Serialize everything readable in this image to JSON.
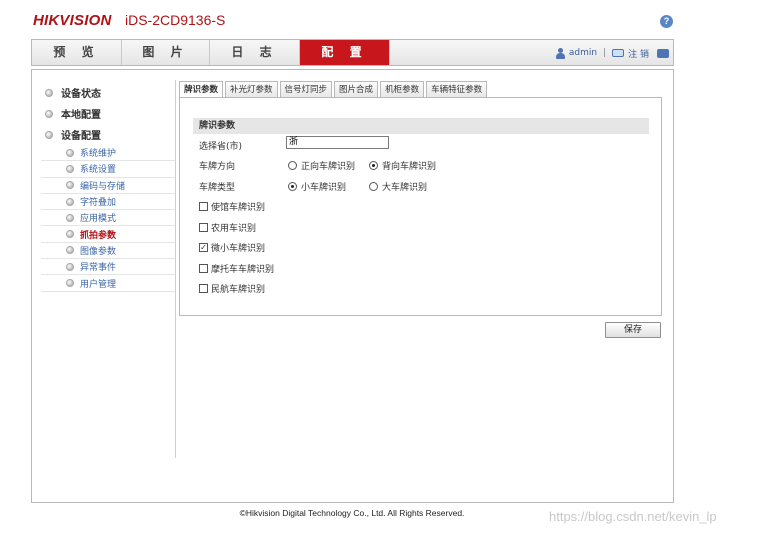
{
  "header": {
    "brand": "HIKVISION",
    "model": "iDS-2CD9136-S",
    "help_symbol": "?",
    "help_icon": "help-icon"
  },
  "nav": {
    "tabs": [
      {
        "label": "预 览"
      },
      {
        "label": "图 片"
      },
      {
        "label": "日 志"
      },
      {
        "label": "配 置"
      }
    ],
    "user": "admin",
    "separator": "|",
    "logout_label": "注 销"
  },
  "sidebar": {
    "top_items": [
      {
        "label": "设备状态"
      },
      {
        "label": "本地配置"
      },
      {
        "label": "设备配置"
      }
    ],
    "sub_items": [
      {
        "label": "系统维护"
      },
      {
        "label": "系统设置"
      },
      {
        "label": "编码与存储"
      },
      {
        "label": "字符叠加"
      },
      {
        "label": "应用模式"
      },
      {
        "label": "抓拍参数"
      },
      {
        "label": "图像参数"
      },
      {
        "label": "异常事件"
      },
      {
        "label": "用户管理"
      }
    ]
  },
  "tabs": [
    {
      "label": "牌识参数"
    },
    {
      "label": "补光灯参数"
    },
    {
      "label": "信号灯同步"
    },
    {
      "label": "图片合成"
    },
    {
      "label": "机柜参数"
    },
    {
      "label": "车辆特征参数"
    }
  ],
  "form": {
    "section_title": "牌识参数",
    "province_label": "选择省(市)",
    "province_value": "浙",
    "direction_label": "车牌方向",
    "direction_options": [
      "正向车牌识别",
      "背向车牌识别"
    ],
    "plate_type_label": "车牌类型",
    "plate_type_options": [
      "小车牌识别",
      "大车牌识别"
    ],
    "checkboxes": [
      {
        "label": "使馆车牌识别",
        "checked": false
      },
      {
        "label": "农用车识别",
        "checked": false
      },
      {
        "label": "微小车牌识别",
        "checked": true
      },
      {
        "label": "摩托车车牌识别",
        "checked": false
      },
      {
        "label": "民航车牌识别",
        "checked": false
      }
    ],
    "check_mark": "✓",
    "save_label": "保存"
  },
  "footer": {
    "copyright": "©Hikvision Digital Technology Co., Ltd. All Rights Reserved."
  },
  "watermark": "https://blog.csdn.net/kevin_lp"
}
